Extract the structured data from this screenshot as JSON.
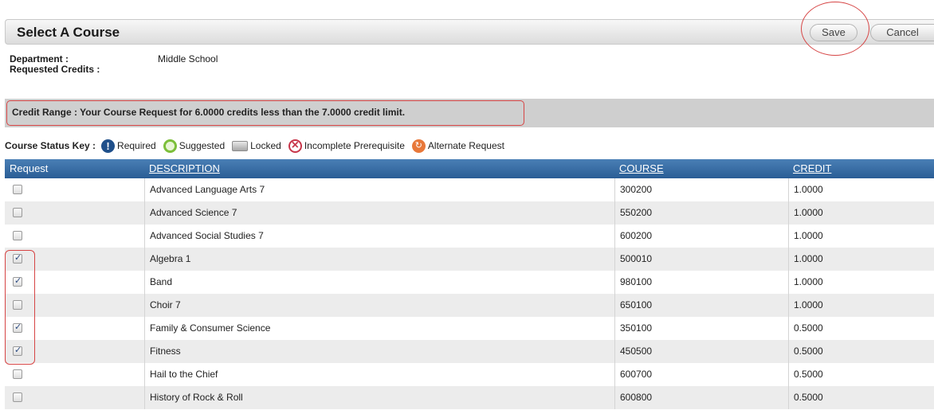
{
  "header": {
    "title": "Select A Course",
    "save_label": "Save",
    "cancel_label": "Cancel"
  },
  "info": {
    "department_label": "Department :",
    "department_value": "Middle School",
    "requested_credits_label": "Requested Credits :"
  },
  "credit_range": "Credit Range : Your Course Request for 6.0000 credits less than the 7.0000 credit limit.",
  "status_key": {
    "label": "Course Status Key :",
    "items": [
      {
        "icon": "required-icon",
        "text": "Required"
      },
      {
        "icon": "suggested-icon",
        "text": "Suggested"
      },
      {
        "icon": "locked-icon",
        "text": "Locked"
      },
      {
        "icon": "incomplete-prerequisite-icon",
        "text": "Incomplete Prerequisite"
      },
      {
        "icon": "alternate-request-icon",
        "text": "Alternate Request"
      }
    ]
  },
  "table": {
    "columns": [
      "Request",
      "DESCRIPTION",
      "COURSE",
      "CREDIT"
    ],
    "rows": [
      {
        "checked": false,
        "description": "Advanced Language Arts 7",
        "course": "300200",
        "credit": "1.0000"
      },
      {
        "checked": false,
        "description": "Advanced Science 7",
        "course": "550200",
        "credit": "1.0000"
      },
      {
        "checked": false,
        "description": "Advanced Social Studies 7",
        "course": "600200",
        "credit": "1.0000"
      },
      {
        "checked": true,
        "description": "Algebra 1",
        "course": "500010",
        "credit": "1.0000"
      },
      {
        "checked": true,
        "description": "Band",
        "course": "980100",
        "credit": "1.0000"
      },
      {
        "checked": false,
        "description": "Choir 7",
        "course": "650100",
        "credit": "1.0000"
      },
      {
        "checked": true,
        "description": "Family & Consumer Science",
        "course": "350100",
        "credit": "0.5000"
      },
      {
        "checked": true,
        "description": "Fitness",
        "course": "450500",
        "credit": "0.5000"
      },
      {
        "checked": false,
        "description": "Hail to the Chief",
        "course": "600700",
        "credit": "0.5000"
      },
      {
        "checked": false,
        "description": "History of Rock & Roll",
        "course": "600800",
        "credit": "0.5000"
      }
    ]
  },
  "colors": {
    "header_blue": "#2a5d95",
    "annotation_red": "#d64545",
    "suggested_green": "#7cbf3a",
    "alternate_orange": "#e8783a"
  }
}
